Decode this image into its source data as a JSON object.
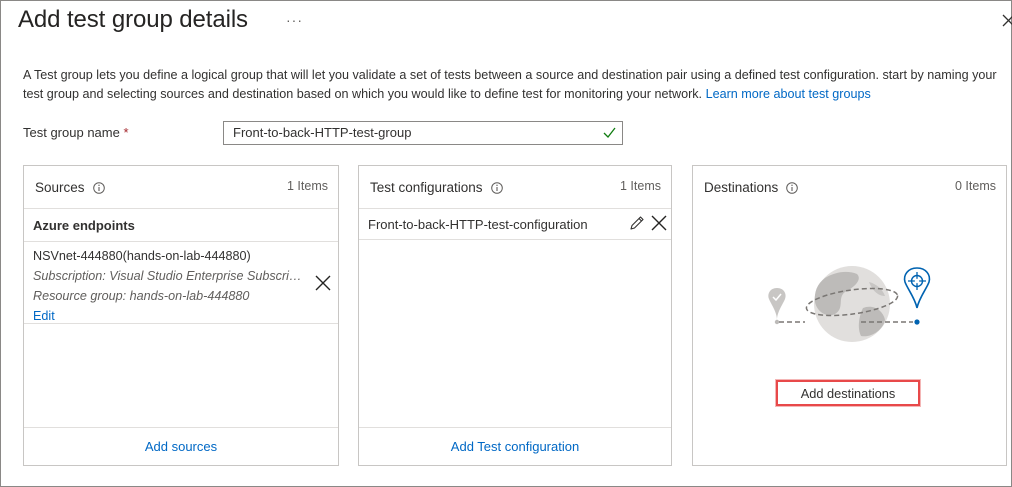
{
  "header": {
    "title": "Add test group details",
    "more_label": "···"
  },
  "description": {
    "text": "A Test group lets you define a logical group that will let you validate a set of tests between a source and destination pair using a defined test configuration. start by naming your test group and selecting sources and destination based on which you would like to define test for monitoring your network. ",
    "link": "Learn more about test groups"
  },
  "form": {
    "name_label": "Test group name",
    "required_mark": "*",
    "name_value": "Front-to-back-HTTP-test-group"
  },
  "sources": {
    "title": "Sources",
    "count": "1 Items",
    "group_heading": "Azure endpoints",
    "items": [
      {
        "name": "NSVnet-444880(hands-on-lab-444880)",
        "subscription": "Subscription: Visual Studio Enterprise Subscription",
        "resource_group": "Resource group: hands-on-lab-444880",
        "edit_label": "Edit"
      }
    ],
    "footer_link": "Add sources"
  },
  "test_configurations": {
    "title": "Test configurations",
    "count": "1 Items",
    "items": [
      {
        "name": "Front-to-back-HTTP-test-configuration"
      }
    ],
    "footer_link": "Add Test configuration"
  },
  "destinations": {
    "title": "Destinations",
    "count": "0 Items",
    "add_button": "Add destinations"
  },
  "colors": {
    "link": "#0068c5",
    "required": "#a4262c",
    "highlight_border": "#e8494a",
    "valid_check": "#107c10",
    "illustration_blue": "#0063b1"
  },
  "icons": [
    "more-icon",
    "close-icon",
    "check-icon",
    "info-icon",
    "remove-icon",
    "edit-icon",
    "globe-illustration"
  ]
}
